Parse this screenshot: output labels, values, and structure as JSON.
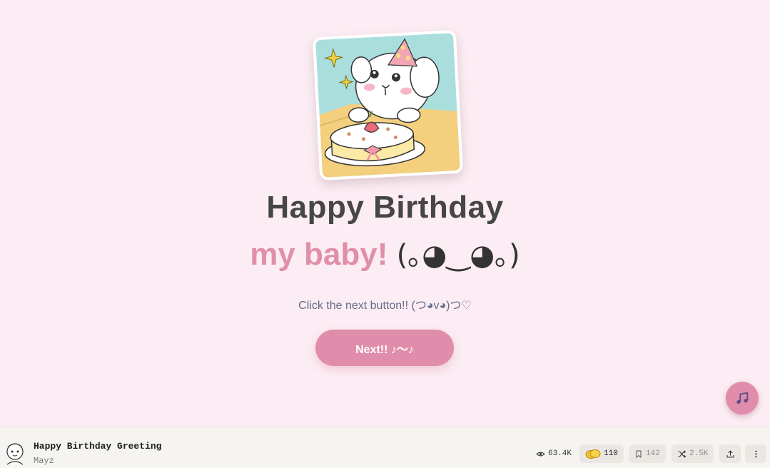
{
  "greeting": {
    "title": "Happy Birthday",
    "subtitle_pink": "my baby!",
    "subtitle_face": "(｡◕‿◕｡)",
    "hint": "Click the next button!! (つ◕v◕)つ♡",
    "next_button_label": "Next!! ♪〜♪"
  },
  "music_button": {
    "icon": "music-note-icon"
  },
  "footer": {
    "title": "Happy Birthday Greeting",
    "author": "Mayz",
    "views": "63.4K",
    "coins": "110",
    "bookmarks": "142",
    "remixes": "2.5K"
  },
  "colors": {
    "background": "#fbedf3",
    "accent_pink": "#e08dab",
    "title_gray": "#464646",
    "hint_gray": "#676a86",
    "footer_bg": "#f5f4f0"
  }
}
